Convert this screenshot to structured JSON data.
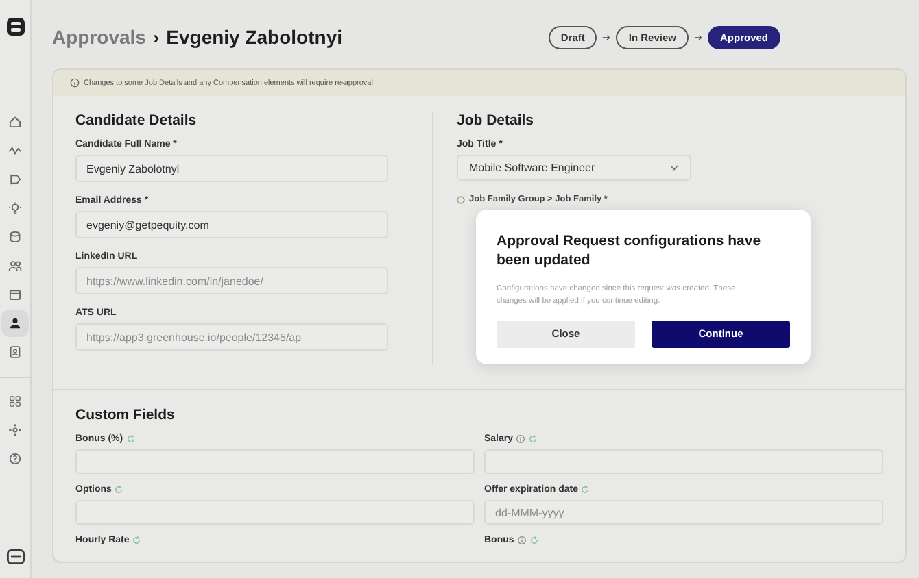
{
  "sidebar": {
    "items": [
      {
        "selected": false
      },
      {
        "selected": false
      },
      {
        "selected": false
      },
      {
        "selected": false
      },
      {
        "selected": false
      },
      {
        "selected": false
      },
      {
        "selected": false
      },
      {
        "selected": true
      },
      {
        "selected": false
      }
    ],
    "tools": [
      {
        "selected": false
      },
      {
        "selected": false
      },
      {
        "selected": false
      }
    ]
  },
  "breadcrumb": {
    "parent": "Approvals",
    "separator": "›",
    "current": "Evgeniy Zabolotnyi"
  },
  "steps": [
    {
      "label": "Draft",
      "selected": false
    },
    {
      "label": "In Review",
      "selected": false
    },
    {
      "label": "Approved",
      "selected": true
    }
  ],
  "banner": {
    "text": "Changes to some Job Details and any Compensation elements will require re-approval"
  },
  "candidate": {
    "title": "Candidate Details",
    "fields": [
      {
        "label": "Candidate Full Name *",
        "kind": "text",
        "value": "Evgeniy Zabolotnyi"
      },
      {
        "label": "Email Address *",
        "kind": "text",
        "value": "evgeniy@getpequity.com"
      },
      {
        "label": "LinkedIn URL",
        "kind": "text",
        "placeholder": "https://www.linkedin.com/in/janedoe/"
      },
      {
        "label": "ATS URL",
        "kind": "text",
        "placeholder": "https://app3.greenhouse.io/people/12345/ap"
      }
    ]
  },
  "job": {
    "title": "Job Details",
    "fields": [
      {
        "label": "Job Title *",
        "kind": "select",
        "value": "Mobile Software Engineer"
      },
      {
        "label": "Job Family Group > Job Family *",
        "kind": "label"
      }
    ]
  },
  "custom_fields": {
    "title": "Custom Fields",
    "fields": [
      {
        "label": "Bonus (%)",
        "info": false,
        "refresh": true
      },
      {
        "label": "Salary",
        "info": true,
        "refresh": true
      },
      {
        "label": "Options",
        "info": false,
        "refresh": true
      },
      {
        "label": "Offer expiration date",
        "info": false,
        "refresh": true,
        "placeholder": "dd-MMM-yyyy"
      },
      {
        "label": "Hourly Rate",
        "info": false,
        "refresh": true
      },
      {
        "label": "Bonus",
        "info": true,
        "refresh": true
      }
    ]
  },
  "dialog": {
    "title": "Approval Request configurations have been updated",
    "message": "Configurations have changed since this request was created. These changes will be applied if you continue editing.",
    "buttons": [
      {
        "label": "Close",
        "kind": "secondary"
      },
      {
        "label": "Continue",
        "kind": "primary"
      }
    ]
  }
}
